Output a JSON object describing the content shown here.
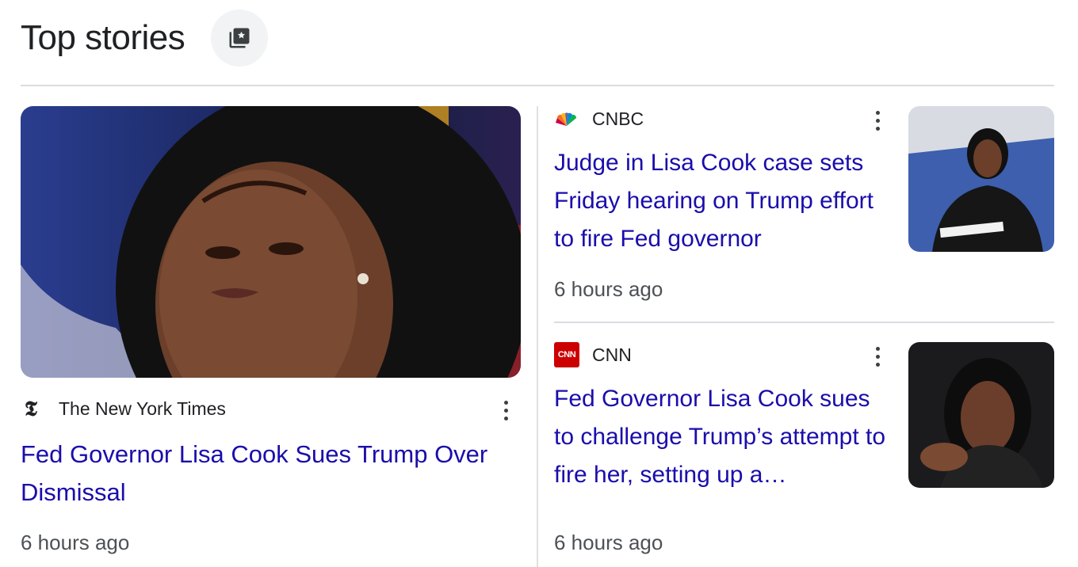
{
  "section": {
    "title": "Top stories"
  },
  "stories": [
    {
      "source": "The New York Times",
      "headline": "Fed Governor Lisa Cook Sues Trump Over Dismissal",
      "time": "6 hours ago"
    },
    {
      "source": "CNBC",
      "headline": "Judge in Lisa Cook case sets Friday hearing on Trump effort to fire Fed governor",
      "time": "6 hours ago"
    },
    {
      "source": "CNN",
      "headline": "Fed Governor Lisa Cook sues to challenge Trump’s attempt to fire her, setting up a…",
      "time": "6 hours ago",
      "logo_text": "CNN"
    }
  ],
  "icons": {
    "title_button": "star-collection-icon",
    "menu": "more-vert-icon"
  },
  "colors": {
    "headline_link": "#1a0dab",
    "meta_text": "#4d5156",
    "divider": "#dadce0",
    "cnn_red": "#cc0000"
  }
}
